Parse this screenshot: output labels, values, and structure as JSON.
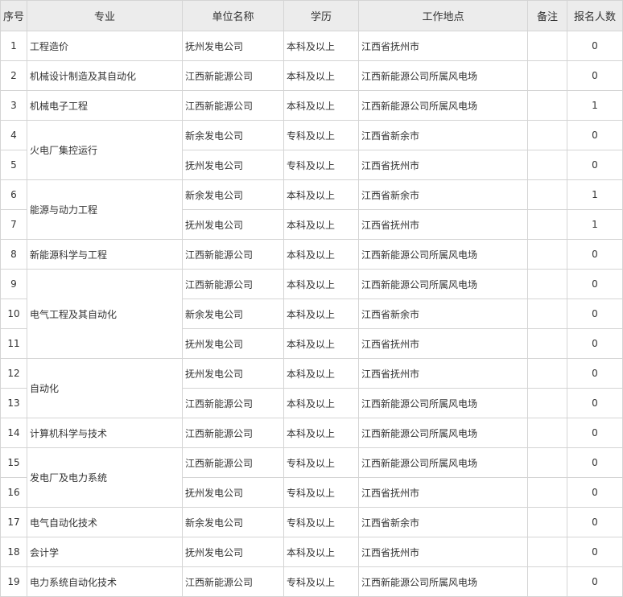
{
  "headers": [
    "序号",
    "专业",
    "单位名称",
    "学历",
    "工作地点",
    "备注",
    "报名人数"
  ],
  "rows": [
    {
      "no": "1",
      "major": "工程造价",
      "unit": "抚州发电公司",
      "edu": "本科及以上",
      "loc": "江西省抚州市",
      "note": "",
      "count": "0"
    },
    {
      "no": "2",
      "major": "机械设计制造及其自动化",
      "unit": "江西新能源公司",
      "edu": "本科及以上",
      "loc": "江西新能源公司所属风电场",
      "note": "",
      "count": "0"
    },
    {
      "no": "3",
      "major": "机械电子工程",
      "unit": "江西新能源公司",
      "edu": "本科及以上",
      "loc": "江西新能源公司所属风电场",
      "note": "",
      "count": "1"
    },
    {
      "no": "4",
      "major": "火电厂集控运行",
      "unit": "新余发电公司",
      "edu": "专科及以上",
      "loc": "江西省新余市",
      "note": "",
      "count": "0"
    },
    {
      "no": "5",
      "major": "",
      "unit": "抚州发电公司",
      "edu": "专科及以上",
      "loc": "江西省抚州市",
      "note": "",
      "count": "0"
    },
    {
      "no": "6",
      "major": "能源与动力工程",
      "unit": "新余发电公司",
      "edu": "本科及以上",
      "loc": "江西省新余市",
      "note": "",
      "count": "1"
    },
    {
      "no": "7",
      "major": "",
      "unit": "抚州发电公司",
      "edu": "本科及以上",
      "loc": "江西省抚州市",
      "note": "",
      "count": "1"
    },
    {
      "no": "8",
      "major": "新能源科学与工程",
      "unit": "江西新能源公司",
      "edu": "本科及以上",
      "loc": "江西新能源公司所属风电场",
      "note": "",
      "count": "0"
    },
    {
      "no": "9",
      "major": "电气工程及其自动化",
      "unit": "江西新能源公司",
      "edu": "本科及以上",
      "loc": "江西新能源公司所属风电场",
      "note": "",
      "count": "0"
    },
    {
      "no": "10",
      "major": "",
      "unit": "新余发电公司",
      "edu": "本科及以上",
      "loc": "江西省新余市",
      "note": "",
      "count": "0"
    },
    {
      "no": "11",
      "major": "",
      "unit": "抚州发电公司",
      "edu": "本科及以上",
      "loc": "江西省抚州市",
      "note": "",
      "count": "0"
    },
    {
      "no": "12",
      "major": "自动化",
      "unit": "抚州发电公司",
      "edu": "本科及以上",
      "loc": "江西省抚州市",
      "note": "",
      "count": "0"
    },
    {
      "no": "13",
      "major": "",
      "unit": "江西新能源公司",
      "edu": "本科及以上",
      "loc": "江西新能源公司所属风电场",
      "note": "",
      "count": "0"
    },
    {
      "no": "14",
      "major": "计算机科学与技术",
      "unit": "江西新能源公司",
      "edu": "本科及以上",
      "loc": "江西新能源公司所属风电场",
      "note": "",
      "count": "0"
    },
    {
      "no": "15",
      "major": "发电厂及电力系统",
      "unit": "江西新能源公司",
      "edu": "专科及以上",
      "loc": "江西新能源公司所属风电场",
      "note": "",
      "count": "0"
    },
    {
      "no": "16",
      "major": "",
      "unit": "抚州发电公司",
      "edu": "专科及以上",
      "loc": "江西省抚州市",
      "note": "",
      "count": "0"
    },
    {
      "no": "17",
      "major": "电气自动化技术",
      "unit": "新余发电公司",
      "edu": "专科及以上",
      "loc": "江西省新余市",
      "note": "",
      "count": "0"
    },
    {
      "no": "18",
      "major": "会计学",
      "unit": "抚州发电公司",
      "edu": "本科及以上",
      "loc": "江西省抚州市",
      "note": "",
      "count": "0"
    },
    {
      "no": "19",
      "major": "电力系统自动化技术",
      "unit": "江西新能源公司",
      "edu": "专科及以上",
      "loc": "江西新能源公司所属风电场",
      "note": "",
      "count": "0"
    }
  ]
}
